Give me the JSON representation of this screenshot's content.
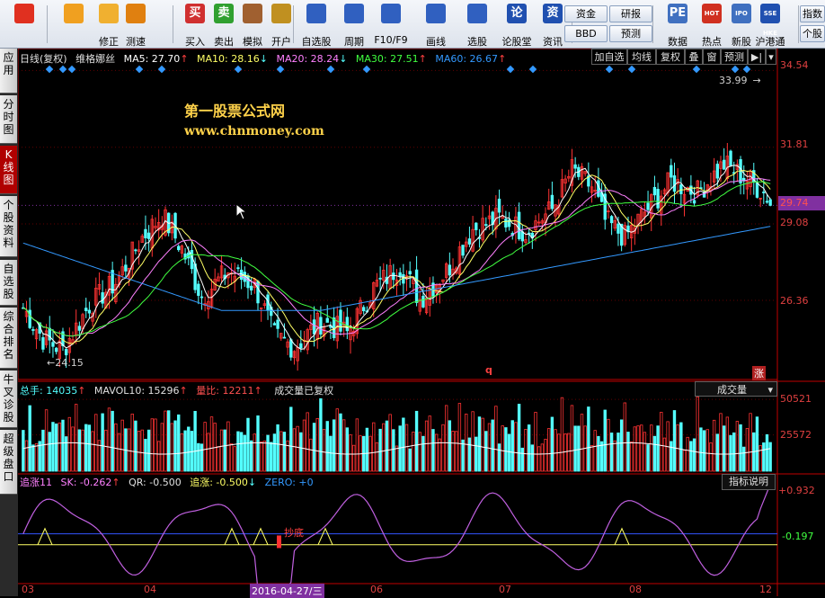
{
  "toolbar": {
    "buttons": [
      {
        "label": "",
        "icon": "grid-logo-icon"
      },
      {
        "label": "",
        "icon": "back-arrow-icon"
      },
      {
        "label": "修正",
        "icon": "up-down-icon"
      },
      {
        "label": "测速",
        "icon": "speedometer-icon"
      },
      {
        "label": "买入",
        "icon": "buy-icon",
        "glyph": "买"
      },
      {
        "label": "卖出",
        "icon": "sell-icon",
        "glyph": "卖"
      },
      {
        "label": "模拟",
        "icon": "hammer-icon"
      },
      {
        "label": "开户",
        "icon": "lock-icon"
      },
      {
        "label": "自选股",
        "icon": "star-icon"
      },
      {
        "label": "周期",
        "icon": "cycle-icon"
      },
      {
        "label": "F10/F9",
        "icon": "f10-icon"
      },
      {
        "label": "画线",
        "icon": "pen-icon"
      },
      {
        "label": "选股",
        "icon": "monitor-icon"
      },
      {
        "label": "论股堂",
        "icon": "forum-icon",
        "glyph": "论"
      },
      {
        "label": "资讯",
        "icon": "news-icon",
        "glyph": "资"
      },
      {
        "label": "数据",
        "icon": "pe-icon",
        "glyph": "PE"
      },
      {
        "label": "热点",
        "icon": "hot-icon",
        "glyph": "HOT"
      },
      {
        "label": "新股",
        "icon": "ipo-icon",
        "glyph": "IPO"
      },
      {
        "label": "沪港通",
        "icon": "sse-hke-icon",
        "glyph": "SSE HKE"
      }
    ],
    "pair1": [
      "资金",
      "BBD"
    ],
    "pair2": [
      "研报",
      "预测"
    ],
    "right_pair": [
      "指数",
      "个股"
    ]
  },
  "sidebar": [
    {
      "label": "应用"
    },
    {
      "label": "分时图"
    },
    {
      "label": "K线图"
    },
    {
      "label": "个股资料"
    },
    {
      "label": "自选股"
    },
    {
      "label": "综合排名"
    },
    {
      "label": "牛叉诊股"
    },
    {
      "label": "超级盘口"
    }
  ],
  "price_header": {
    "period": "日线(复权)",
    "name": "维格娜丝",
    "ma5": "MA5: 27.70",
    "ma10": "MA10: 28.16",
    "ma20": "MA20: 28.24",
    "ma30": "MA30: 27.51",
    "ma60": "MA60: 26.67"
  },
  "panel_buttons": [
    "加自选",
    "均线",
    "复权",
    "叠",
    "窗",
    "预测"
  ],
  "price_axis": [
    "34.54",
    "31.81",
    "29.08",
    "26.36"
  ],
  "current_price": "29.74",
  "high_label": "33.99",
  "low_label": "24.15",
  "watermark": {
    "line1": "第一股票公式网",
    "line2": "www.chnmoney.com"
  },
  "markers": {
    "q": "q",
    "zhang": "涨"
  },
  "vol_header": {
    "total": "总手: 14035",
    "mavol": "MAVOL10: 15296",
    "ratio": "量比: 12211",
    "note": "成交量已复权"
  },
  "vol_select": "成交量",
  "vol_axis": [
    "50521",
    "25572"
  ],
  "ind_header": {
    "name": "追涨11",
    "sk": "SK: -0.262",
    "qr": "QR: -0.500",
    "zz": "追涨: -0.500",
    "zero": "ZERO: +0"
  },
  "ind_button": "指标说明",
  "ind_axis": [
    "+0.932",
    "-0.197"
  ],
  "ind_label": "抄底",
  "x_axis": [
    "03",
    "04",
    "06",
    "07",
    "08",
    "12"
  ],
  "date_highlight": "2016-04-27/三",
  "chart_data": {
    "type": "candlestick",
    "y_axis_ticks": [
      26.36,
      29.08,
      31.81,
      34.54
    ],
    "high": 33.99,
    "low": 24.15,
    "last": 29.74,
    "ma": {
      "MA5": 27.7,
      "MA10": 28.16,
      "MA20": 28.24,
      "MA30": 27.51,
      "MA60": 26.67
    },
    "volume": {
      "total": 14035,
      "mavol10": 15296,
      "ratio": 12211,
      "ticks": [
        25572,
        50521
      ]
    },
    "indicator": {
      "SK": -0.262,
      "QR": -0.5,
      "ZZ": -0.5,
      "ZERO": 0,
      "ticks": [
        -0.197,
        0.932
      ]
    },
    "x_ticks": [
      "03",
      "04",
      "06",
      "07",
      "08",
      "12"
    ],
    "colors": {
      "up": "#ff3333",
      "down": "#54ffff",
      "ma5": "#ffffff",
      "ma10": "#ffff66",
      "ma20": "#ff80ff",
      "ma30": "#40ff40",
      "ma60": "#3399ff",
      "axis": "#c00000"
    }
  }
}
